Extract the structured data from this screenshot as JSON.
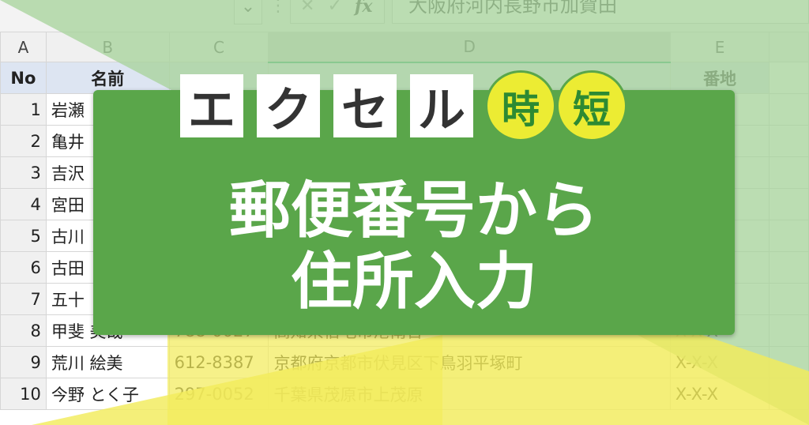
{
  "formula_bar": {
    "dropdown_icon": "chevron-down-icon",
    "cancel_icon": "close-icon",
    "confirm_icon": "check-icon",
    "fx_label": "fx",
    "value": "大阪府河内長野市加賀田"
  },
  "columns": [
    "A",
    "B",
    "C",
    "D",
    "E"
  ],
  "header_row": {
    "no": "No",
    "name": "名前",
    "banchi": "番地"
  },
  "rows": [
    {
      "row": "1",
      "name": "岩瀬",
      "zip": "",
      "address": "",
      "banchi": ""
    },
    {
      "row": "2",
      "name": "亀井",
      "zip": "",
      "address": "",
      "banchi": ""
    },
    {
      "row": "3",
      "name": "吉沢",
      "zip": "",
      "address": "",
      "banchi": ""
    },
    {
      "row": "4",
      "name": "宮田",
      "zip": "",
      "address": "",
      "banchi": ""
    },
    {
      "row": "5",
      "name": "古川",
      "zip": "",
      "address": "",
      "banchi": ""
    },
    {
      "row": "6",
      "name": "古田",
      "zip": "",
      "address": "",
      "banchi": ""
    },
    {
      "row": "7",
      "name": "五十",
      "zip": "",
      "address": "",
      "banchi": ""
    },
    {
      "row": "8",
      "name": "甲斐 美哉",
      "zip": "788-0027",
      "address": "高知県宿毛市港南台",
      "banchi": "X-X-X"
    },
    {
      "row": "9",
      "name": "荒川 絵美",
      "zip": "612-8387",
      "address": "京都府京都市伏見区下鳥羽平塚町",
      "banchi": "X-X-X"
    },
    {
      "row": "10",
      "name": "今野 とく子",
      "zip": "297-0052",
      "address": "千葉県茂原市上茂原",
      "banchi": "X-X-X"
    }
  ],
  "banner": {
    "kana": [
      "エ",
      "ク",
      "セ",
      "ル"
    ],
    "circle_1": "時",
    "circle_2": "短",
    "line_1": "郵便番号から",
    "line_2": "住所入力"
  },
  "colors": {
    "panel_green": "#5aa64a",
    "light_green": "#a8d49c",
    "yellow": "#f2ec5c",
    "circle_yellow": "#ecec33",
    "header_blue": "#dde5f2"
  }
}
